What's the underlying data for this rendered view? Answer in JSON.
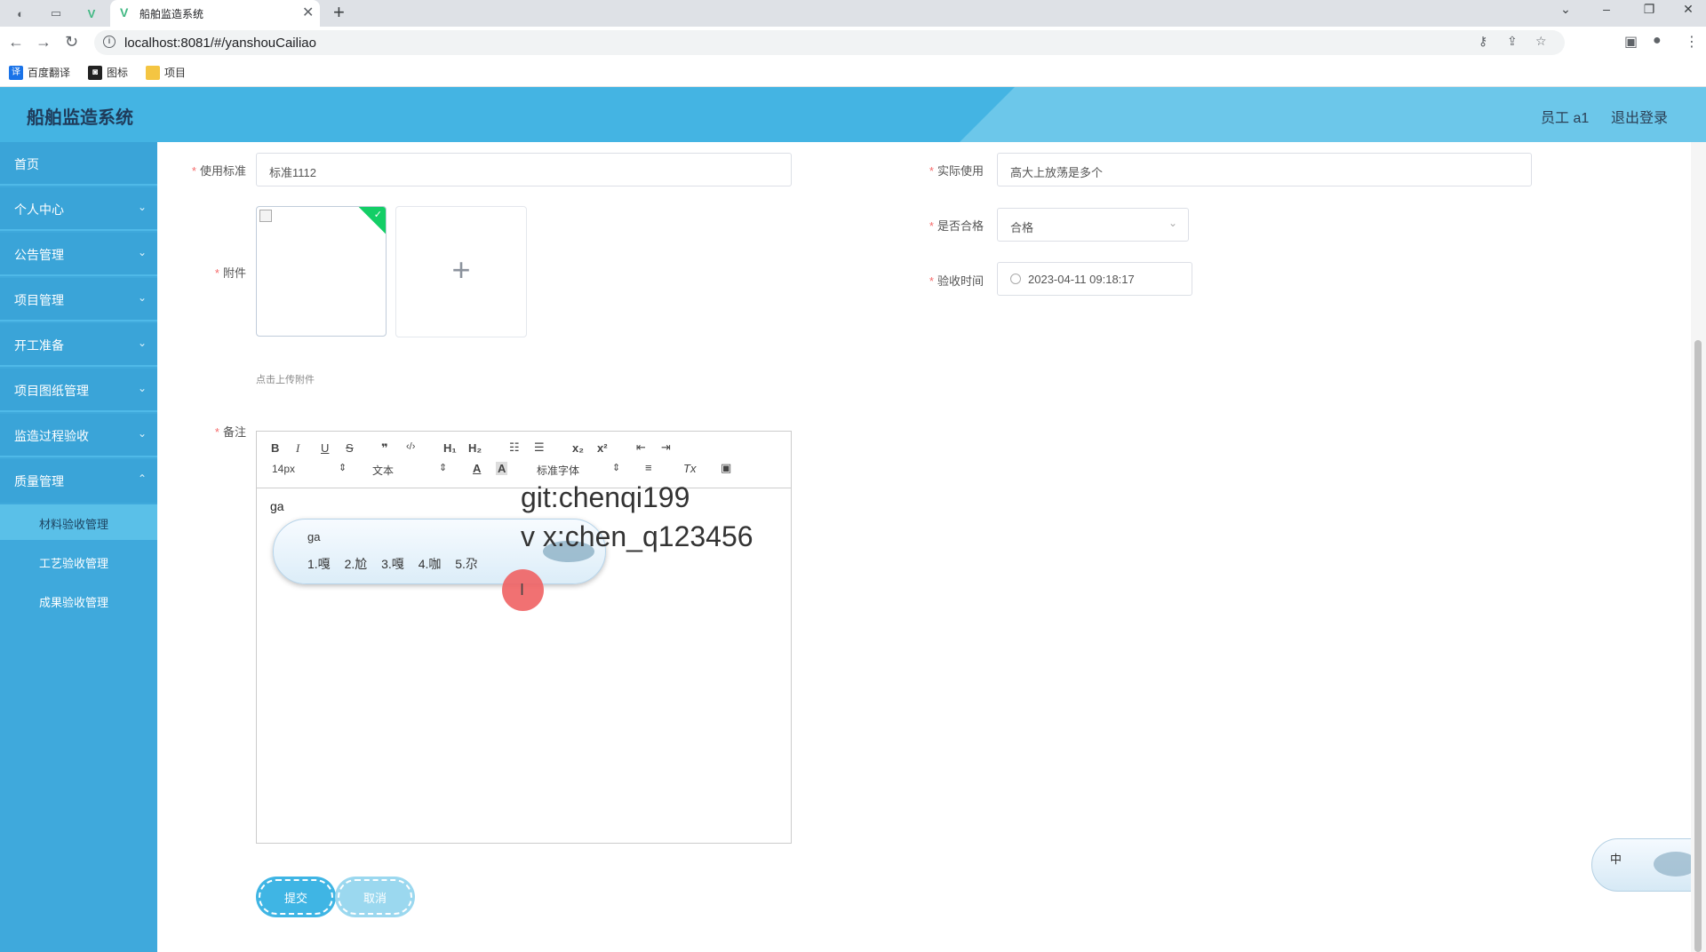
{
  "browser": {
    "tab_title": "船舶监造系统",
    "tab_close": "✕",
    "new_tab": "+",
    "url": "localhost:8081/#/yanshouCailiao",
    "bookmarks": [
      {
        "label": "百度翻译",
        "icon": "translate-icon",
        "color": "#1a73e8"
      },
      {
        "label": "图标",
        "icon": "image-icon",
        "color": "#222222"
      },
      {
        "label": "项目",
        "icon": "folder-icon",
        "color": "#f4c542"
      }
    ]
  },
  "header": {
    "title": "船舶监造系统",
    "user": "员工 a1",
    "logout": "退出登录",
    "color": "#44b4e3"
  },
  "sidebar": {
    "items": [
      {
        "label": "首页",
        "has_children": false
      },
      {
        "label": "个人中心",
        "has_children": true
      },
      {
        "label": "公告管理",
        "has_children": true
      },
      {
        "label": "项目管理",
        "has_children": true
      },
      {
        "label": "开工准备",
        "has_children": true
      },
      {
        "label": "项目图纸管理",
        "has_children": true
      },
      {
        "label": "监造过程验收",
        "has_children": true
      },
      {
        "label": "质量管理",
        "has_children": true
      }
    ],
    "subitems": [
      {
        "label": "材料验收管理",
        "active": true
      },
      {
        "label": "工艺验收管理",
        "active": false
      },
      {
        "label": "成果验收管理",
        "active": false
      }
    ]
  },
  "form": {
    "standard": {
      "label": "使用标准",
      "value": "标准1112"
    },
    "actual_use": {
      "label": "实际使用",
      "value": "高大上放荡是多个"
    },
    "qualified": {
      "label": "是否合格",
      "value": "合格"
    },
    "inspect_time": {
      "label": "验收时间",
      "value": "2023-04-11 09:18:17"
    },
    "attachment": {
      "label": "附件",
      "hint": "点击上传附件"
    },
    "remark": {
      "label": "备注",
      "content": "ga"
    },
    "required_mark": "*"
  },
  "editor": {
    "font_size": "14px",
    "format": "文本",
    "font_family": "标准字体",
    "buttons": {
      "bold": "B",
      "italic": "I",
      "underline": "U",
      "strike": "S",
      "quote": "❞",
      "code": "‹/›",
      "h1": "H₁",
      "h2": "H₂",
      "ol": "☷",
      "ul": "☰",
      "sub": "x₂",
      "sup": "x²",
      "outdent": "⇤",
      "indent": "⇥",
      "color": "A",
      "background": "A",
      "align": "≡",
      "clean": "Tx",
      "image": "▣"
    }
  },
  "ime": {
    "composition": "ga",
    "candidates": "1.嘎 2.尬 3.嘎 4.咖 5.尕",
    "float_label": "中"
  },
  "overlay": {
    "line1": "git:chenqi199",
    "line2": "v x:chen_q123456"
  },
  "actions": {
    "submit": "提交",
    "cancel": "取消"
  }
}
